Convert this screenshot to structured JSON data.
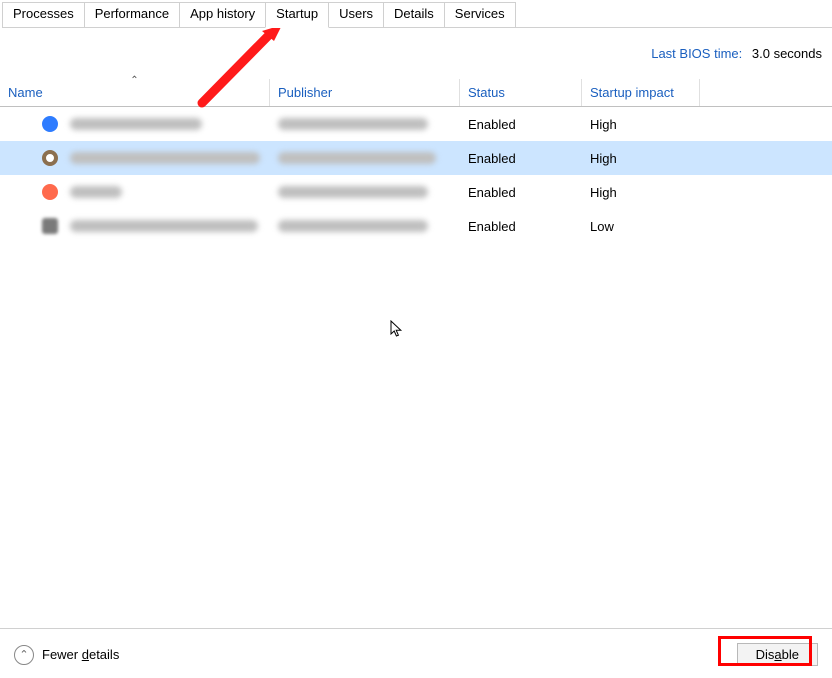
{
  "tabs": [
    {
      "label": "Processes",
      "active": false
    },
    {
      "label": "Performance",
      "active": false
    },
    {
      "label": "App history",
      "active": false
    },
    {
      "label": "Startup",
      "active": true
    },
    {
      "label": "Users",
      "active": false
    },
    {
      "label": "Details",
      "active": false
    },
    {
      "label": "Services",
      "active": false
    }
  ],
  "bios": {
    "label": "Last BIOS time:",
    "value": "3.0 seconds"
  },
  "columns": {
    "name": "Name",
    "publisher": "Publisher",
    "status": "Status",
    "impact": "Startup impact"
  },
  "rows": [
    {
      "icon_color": "#2e7cff",
      "icon_shape": "circle",
      "name_blur_w": 132,
      "pub_blur_w": 150,
      "status": "Enabled",
      "impact": "High",
      "selected": false
    },
    {
      "icon_color": "#8b6f4f",
      "icon_shape": "ring",
      "name_blur_w": 190,
      "pub_blur_w": 158,
      "status": "Enabled",
      "impact": "High",
      "selected": true
    },
    {
      "icon_color": "#ff6a4d",
      "icon_shape": "circle",
      "name_blur_w": 52,
      "pub_blur_w": 150,
      "status": "Enabled",
      "impact": "High",
      "selected": false
    },
    {
      "icon_color": "#7a7a7a",
      "icon_shape": "shield",
      "name_blur_w": 188,
      "pub_blur_w": 150,
      "status": "Enabled",
      "impact": "Low",
      "selected": false
    }
  ],
  "footer": {
    "fewer_details_prefix": "Fewer ",
    "fewer_details_underline": "d",
    "fewer_details_suffix": "etails",
    "disable_prefix": "Dis",
    "disable_underline": "a",
    "disable_suffix": "ble"
  },
  "annotation": {
    "arrow_color": "#ff1a1a"
  }
}
